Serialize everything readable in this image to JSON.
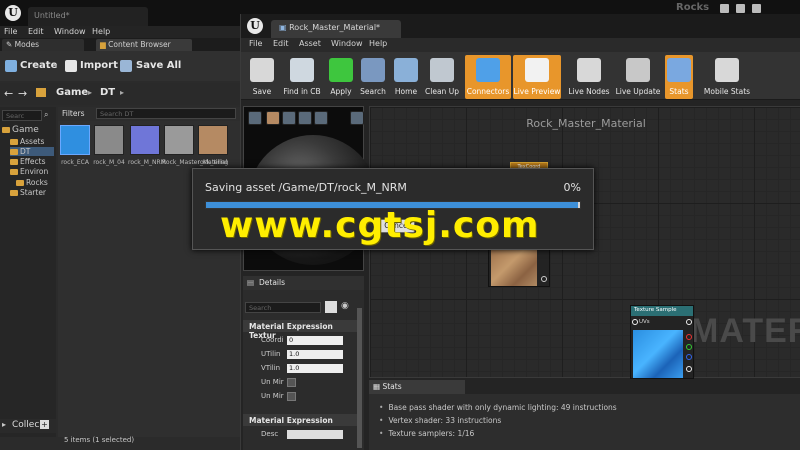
{
  "back_window": {
    "tab_title": "Untitled*",
    "menu": [
      "File",
      "Edit",
      "Window",
      "Help"
    ],
    "dock_tabs": {
      "modes": "Modes",
      "content_browser": "Content Browser"
    },
    "toolbar": {
      "create": "Create",
      "import": "Import",
      "save_all": "Save All"
    },
    "path": [
      "Game",
      "DT"
    ],
    "search_placeholder": "Searc",
    "filters_label": "Filters",
    "search_assets_placeholder": "Search DT",
    "tree": [
      "Game",
      "Assets",
      "DT",
      "Effects",
      "Environ",
      "Rocks",
      "Starter"
    ],
    "assets": [
      {
        "label": "rock_ECA",
        "color": "#2f8fe0"
      },
      {
        "label": "rock_M_04",
        "color": "#8a8a8a"
      },
      {
        "label": "rock_M_NRM",
        "color": "#6f76d8"
      },
      {
        "label": "Rock_Master_Material",
        "color": "#9a9a9a"
      },
      {
        "label": "rock_tiling",
        "color": "#b58a63"
      }
    ],
    "collections_label": "Collec",
    "status": "5 items (1 selected)",
    "top_right_text": "Rocks"
  },
  "front_window": {
    "tab_title": "Rock_Master_Material*",
    "menu": [
      "File",
      "Edit",
      "Asset",
      "Window",
      "Help"
    ],
    "toolbar": [
      {
        "label": "Save",
        "icon": "floppy-icon",
        "active": false
      },
      {
        "label": "Find in CB",
        "icon": "magnifier-icon",
        "active": false
      },
      {
        "label": "Apply",
        "icon": "checkmark-icon",
        "active": false
      },
      {
        "label": "Search",
        "icon": "binoculars-icon",
        "active": false
      },
      {
        "label": "Home",
        "icon": "house-icon",
        "active": false
      },
      {
        "label": "Clean Up",
        "icon": "broom-icon",
        "active": false
      },
      {
        "label": "Connectors",
        "icon": "connectors-icon",
        "active": true
      },
      {
        "label": "Live Preview",
        "icon": "monitor-icon",
        "active": true
      },
      {
        "label": "Live Nodes",
        "icon": "tv-icon",
        "active": false
      },
      {
        "label": "Live Update",
        "icon": "refresh-icon",
        "active": false
      },
      {
        "label": "Stats",
        "icon": "bar-chart-icon",
        "active": true
      },
      {
        "label": "Mobile Stats",
        "icon": "mobile-icon",
        "active": false
      }
    ],
    "graph_title": "Rock_Master_Material",
    "graph_watermark": "MATERI",
    "nodes": {
      "texcoord": "TexCoord",
      "texture_sample": "Texture Sample",
      "uvs_pin": "UVs"
    },
    "details": {
      "tab": "Details",
      "search_placeholder": "Search",
      "section1": "Material Expression Textur",
      "rows": [
        {
          "label": "Coordi",
          "value": "0"
        },
        {
          "label": "UTilin",
          "value": "1.0"
        },
        {
          "label": "VTilin",
          "value": "1.0"
        }
      ],
      "checks": [
        "Un Mir",
        "Un Mir"
      ],
      "section2": "Material Expression",
      "desc_label": "Desc"
    },
    "stats": {
      "tab": "Stats",
      "lines": [
        "Base pass shader with only dynamic lighting: 49 instructions",
        "Vertex shader: 33 instructions",
        "Texture samplers: 1/16"
      ]
    }
  },
  "save_dialog": {
    "text": "Saving asset /Game/DT/rock_M_NRM",
    "percent_text": "0%",
    "progress": 0.995,
    "cancel": "Cancel"
  },
  "watermark": "www.cgtsj.com",
  "colors": {
    "accent_orange": "#e8962b",
    "progress_blue": "#3d8fd8",
    "watermark_yellow": "#ffee00"
  }
}
